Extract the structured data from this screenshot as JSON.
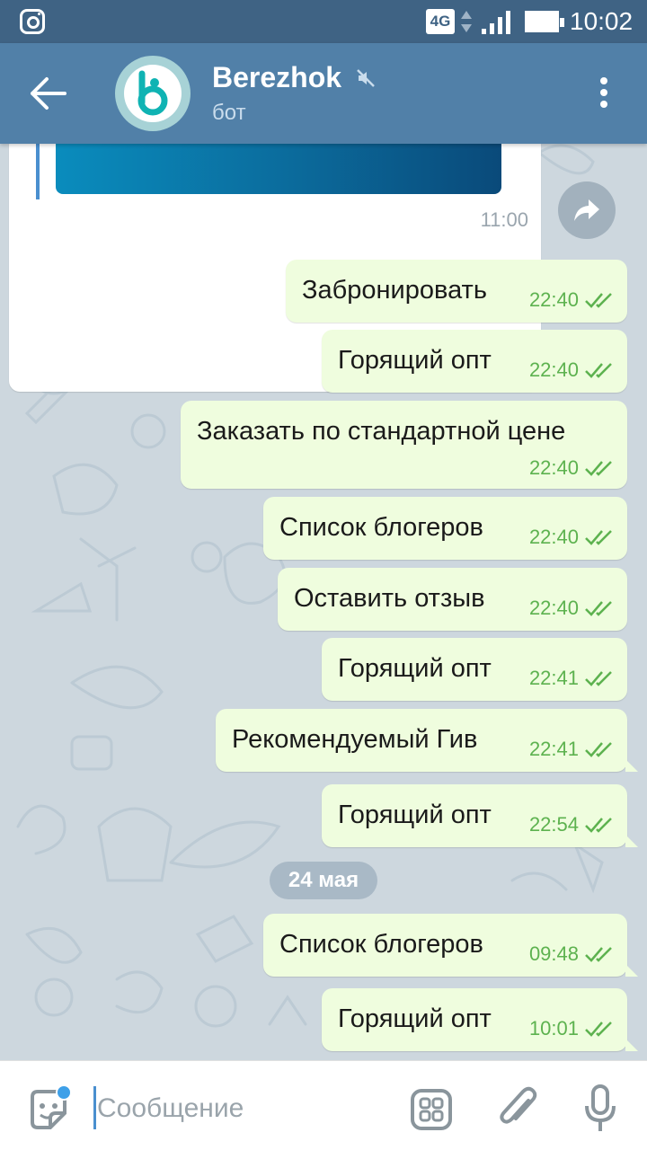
{
  "status_bar": {
    "network": "4G",
    "time": "10:02"
  },
  "header": {
    "title": "Berezhok",
    "subtitle": "бот"
  },
  "incoming": {
    "time": "11:00"
  },
  "messages": [
    {
      "text": "Забронировать",
      "time": "22:40"
    },
    {
      "text": "Горящий опт",
      "time": "22:40"
    },
    {
      "text": "Заказать по стандартной цене",
      "time": "22:40"
    },
    {
      "text": "Список блогеров",
      "time": "22:40"
    },
    {
      "text": "Оставить отзыв",
      "time": "22:40"
    },
    {
      "text": "Горящий опт",
      "time": "22:41"
    },
    {
      "text": "Рекомендуемый Гив",
      "time": "22:41"
    },
    {
      "text": "Горящий опт",
      "time": "22:54"
    },
    {
      "text": "Список блогеров",
      "time": "09:48"
    },
    {
      "text": "Горящий опт",
      "time": "10:01"
    }
  ],
  "date_separator": "24 мая",
  "composer": {
    "placeholder": "Сообщение"
  },
  "colors": {
    "header": "#5180a8",
    "status_bar": "#3f6384",
    "outgoing_bubble": "#effdde",
    "read_check": "#5db24f"
  }
}
